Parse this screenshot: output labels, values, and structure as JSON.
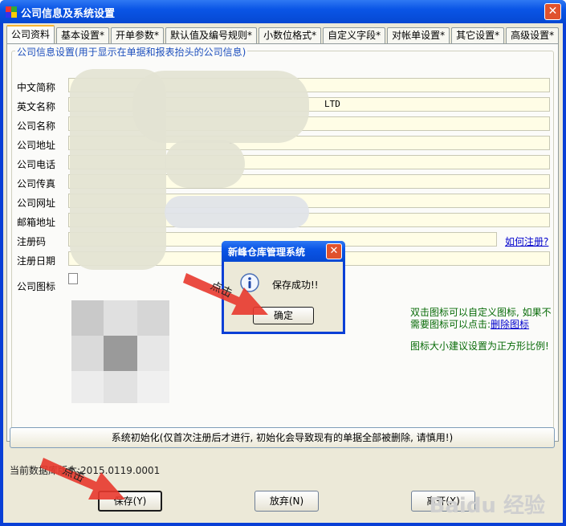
{
  "window": {
    "title": "公司信息及系统设置",
    "close_label": "✕"
  },
  "tabs": [
    "公司资料",
    "基本设置*",
    "开单参数*",
    "默认值及编号规则*",
    "小数位格式*",
    "自定义字段*",
    "对帐单设置*",
    "其它设置*",
    "高级设置*"
  ],
  "group": {
    "legend": "公司信息设置(用于显示在单据和报表抬头的公司信息)"
  },
  "fields": [
    {
      "label": "中文简称",
      "value": ""
    },
    {
      "label": "英文名称",
      "value": "LTD"
    },
    {
      "label": "公司名称",
      "value": ""
    },
    {
      "label": "公司地址",
      "value": "-"
    },
    {
      "label": "公司电话",
      "value": ""
    },
    {
      "label": "公司传真",
      "value": ""
    },
    {
      "label": "公司网址",
      "value": ""
    },
    {
      "label": "邮箱地址",
      "value": ""
    },
    {
      "label": "注册码",
      "value": ""
    },
    {
      "label": "注册日期",
      "value": ""
    },
    {
      "label": "公司图标",
      "value": ""
    }
  ],
  "register_link": "如何注册?",
  "logo_hint": {
    "line1": "双击图标可以自定义图标, 如果不",
    "line2_prefix": "需要图标可以点击:",
    "delete_link": "删除图标",
    "line3": "图标大小建议设置为正方形比例!"
  },
  "init_button": "系统初始化(仅首次注册后才进行, 初始化会导致现有的单据全部被删除, 请慎用!)",
  "version": {
    "prefix": "当前数据库版本:",
    "value": "2015.0119.0001"
  },
  "buttons": {
    "save": "保存(Y)",
    "discard": "放弃(N)",
    "leave": "离开(X)"
  },
  "dialog": {
    "title": "新峰仓库管理系统",
    "message": "保存成功!!",
    "ok": "确定",
    "close_label": "✕"
  },
  "annotations": {
    "click1": "点击",
    "click2": "点击"
  },
  "watermark": "Baidu 经验",
  "colors": {
    "title_bar": "#0a55e6",
    "panel": "#ece9d8",
    "input_bg": "#fffde6",
    "arrow": "#e8392d",
    "hint_green": "#086b08"
  }
}
